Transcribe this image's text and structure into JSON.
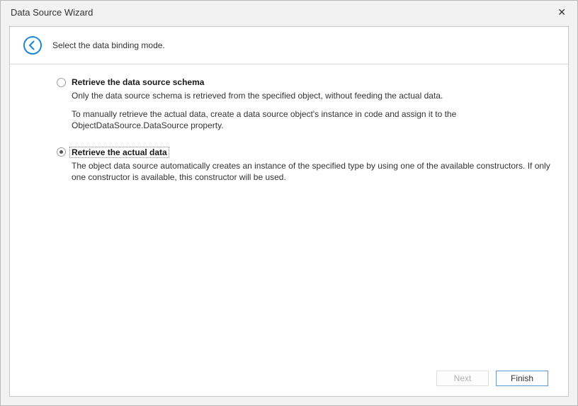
{
  "window": {
    "title": "Data Source Wizard",
    "close_glyph": "✕"
  },
  "header": {
    "instruction": "Select the data binding mode."
  },
  "options": {
    "schema": {
      "title": "Retrieve the data source schema",
      "desc1": "Only the data source schema is retrieved from the specified object, without feeding the actual data.",
      "desc2": "To manually retrieve the actual data, create a data source object's instance in code and assign it to the ObjectDataSource.DataSource property."
    },
    "actual": {
      "title": "Retrieve the actual data",
      "desc1": "The object data source automatically creates an instance of the specified type by using one of the available constructors. If only one constructor is available, this constructor will be used."
    }
  },
  "footer": {
    "next": "Next",
    "finish": "Finish"
  }
}
